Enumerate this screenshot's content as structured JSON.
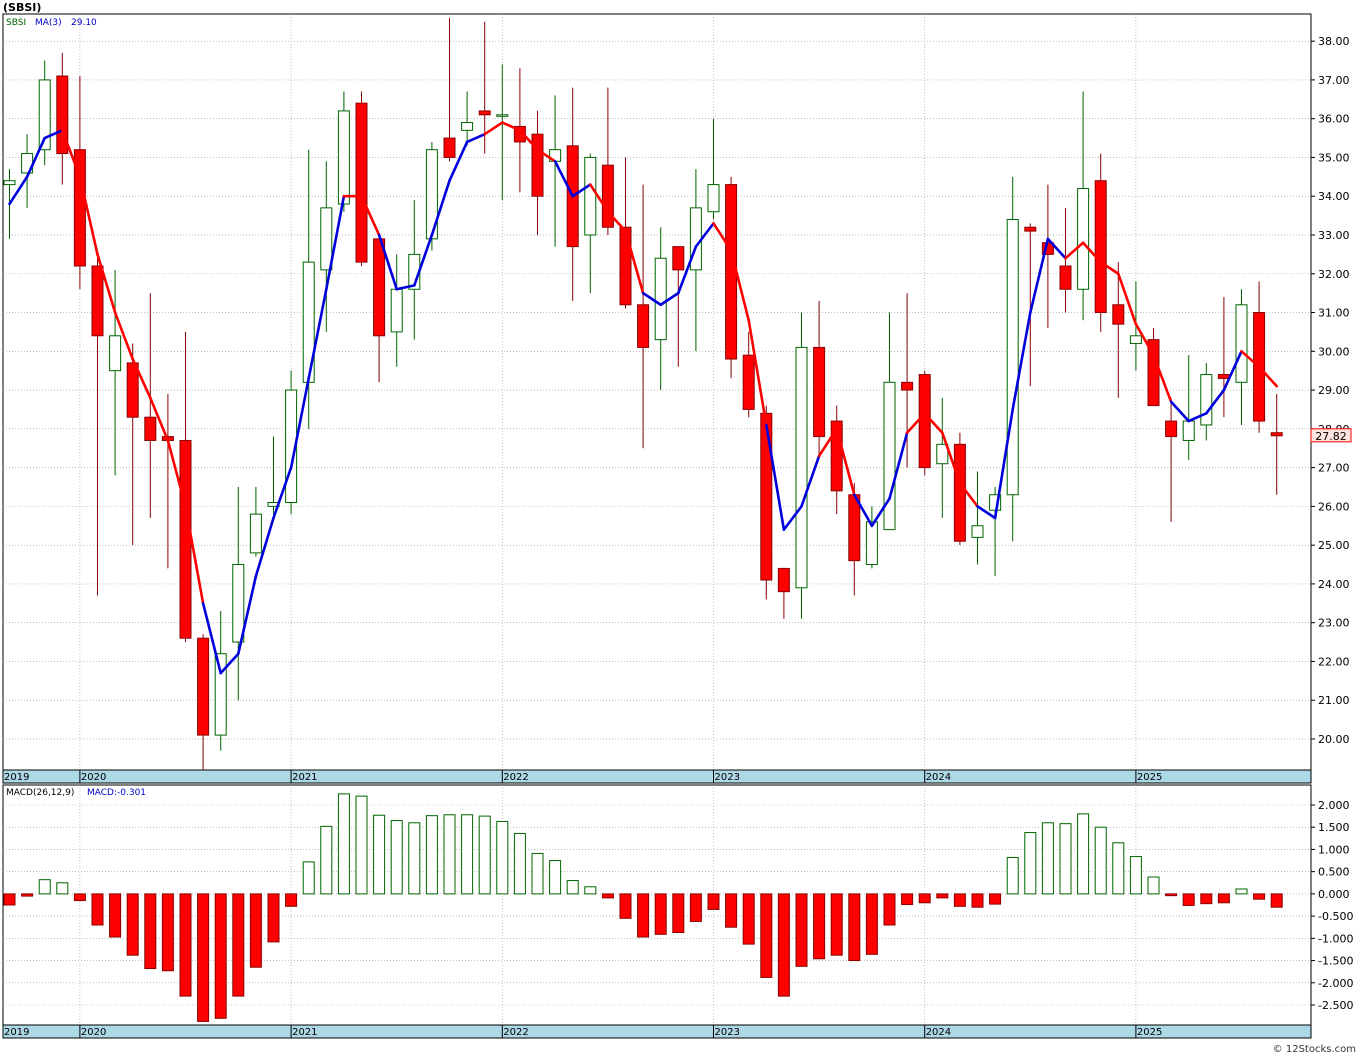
{
  "header": {
    "title": "(SBSI)"
  },
  "price_panel": {
    "symbol_label": "SBSI",
    "ma_label": "MA(3)",
    "ma_value": "29.10",
    "last_price": "27.82"
  },
  "macd_panel": {
    "label": "MACD(26,12,9)",
    "value_label": "MACD:-0.301"
  },
  "footer": {
    "credit": "© 12Stocks.com"
  },
  "colors": {
    "up": "#006400",
    "down": "#ff0000",
    "ma_up": "#0000dd",
    "ma_down": "#ff0000",
    "axis_band": "#add8e6",
    "grid": "#999999"
  },
  "chart_data": [
    {
      "type": "candlestick",
      "interval": "monthly",
      "ylim": [
        19.2,
        38.7
      ],
      "y_ticks": [
        "20.00",
        "21.00",
        "22.00",
        "23.00",
        "24.00",
        "25.00",
        "26.00",
        "27.00",
        "28.00",
        "29.00",
        "30.00",
        "31.00",
        "32.00",
        "33.00",
        "34.00",
        "35.00",
        "36.00",
        "37.00",
        "38.00"
      ],
      "x_labels": [
        "2019",
        "2020",
        "2021",
        "2022",
        "2023",
        "2024",
        "2025"
      ],
      "series": [
        {
          "name": "SBSI",
          "candles": [
            {
              "date": "2019-09",
              "o": 34.3,
              "h": 34.7,
              "l": 32.9,
              "c": 34.4
            },
            {
              "date": "2019-10",
              "o": 34.6,
              "h": 35.6,
              "l": 33.7,
              "c": 35.1
            },
            {
              "date": "2019-11",
              "o": 35.2,
              "h": 37.5,
              "l": 34.8,
              "c": 37.0
            },
            {
              "date": "2019-12",
              "o": 37.1,
              "h": 37.7,
              "l": 34.3,
              "c": 35.1
            },
            {
              "date": "2020-01",
              "o": 35.2,
              "h": 37.1,
              "l": 31.6,
              "c": 32.2
            },
            {
              "date": "2020-02",
              "o": 32.2,
              "h": 32.4,
              "l": 23.7,
              "c": 30.4
            },
            {
              "date": "2020-03",
              "o": 29.5,
              "h": 32.1,
              "l": 26.8,
              "c": 30.4
            },
            {
              "date": "2020-04",
              "o": 29.7,
              "h": 30.2,
              "l": 25.0,
              "c": 28.3
            },
            {
              "date": "2020-05",
              "o": 28.3,
              "h": 31.5,
              "l": 25.7,
              "c": 27.7
            },
            {
              "date": "2020-06",
              "o": 27.8,
              "h": 28.9,
              "l": 24.4,
              "c": 27.7
            },
            {
              "date": "2020-07",
              "o": 27.7,
              "h": 30.5,
              "l": 22.5,
              "c": 22.6
            },
            {
              "date": "2020-08",
              "o": 22.6,
              "h": 22.7,
              "l": 19.2,
              "c": 20.1
            },
            {
              "date": "2020-09",
              "o": 20.1,
              "h": 23.3,
              "l": 19.7,
              "c": 22.2
            },
            {
              "date": "2020-10",
              "o": 22.5,
              "h": 26.5,
              "l": 21.0,
              "c": 24.5
            },
            {
              "date": "2020-11",
              "o": 24.8,
              "h": 26.5,
              "l": 24.7,
              "c": 25.8
            },
            {
              "date": "2020-12",
              "o": 26.0,
              "h": 27.8,
              "l": 25.8,
              "c": 26.1
            },
            {
              "date": "2021-01",
              "o": 26.1,
              "h": 29.5,
              "l": 25.8,
              "c": 29.0
            },
            {
              "date": "2021-02",
              "o": 29.2,
              "h": 35.2,
              "l": 28.0,
              "c": 32.3
            },
            {
              "date": "2021-03",
              "o": 32.1,
              "h": 34.9,
              "l": 30.5,
              "c": 33.7
            },
            {
              "date": "2021-04",
              "o": 33.8,
              "h": 36.7,
              "l": 33.6,
              "c": 36.2
            },
            {
              "date": "2021-05",
              "o": 36.4,
              "h": 36.7,
              "l": 32.2,
              "c": 32.3
            },
            {
              "date": "2021-06",
              "o": 32.9,
              "h": 33.0,
              "l": 29.2,
              "c": 30.4
            },
            {
              "date": "2021-07",
              "o": 30.5,
              "h": 32.5,
              "l": 29.6,
              "c": 31.6
            },
            {
              "date": "2021-08",
              "o": 31.6,
              "h": 33.9,
              "l": 30.3,
              "c": 32.5
            },
            {
              "date": "2021-09",
              "o": 32.9,
              "h": 35.4,
              "l": 32.6,
              "c": 35.2
            },
            {
              "date": "2021-10",
              "o": 35.5,
              "h": 38.6,
              "l": 34.9,
              "c": 35.0
            },
            {
              "date": "2021-11",
              "o": 35.7,
              "h": 36.7,
              "l": 35.3,
              "c": 35.9
            },
            {
              "date": "2021-12",
              "o": 36.2,
              "h": 38.5,
              "l": 35.1,
              "c": 36.1
            },
            {
              "date": "2022-01",
              "o": 36.1,
              "h": 37.4,
              "l": 33.9,
              "c": 36.1
            },
            {
              "date": "2022-02",
              "o": 35.8,
              "h": 37.3,
              "l": 34.1,
              "c": 35.4
            },
            {
              "date": "2022-03",
              "o": 35.6,
              "h": 36.2,
              "l": 33.0,
              "c": 34.0
            },
            {
              "date": "2022-04",
              "o": 34.9,
              "h": 36.6,
              "l": 32.7,
              "c": 35.2
            },
            {
              "date": "2022-05",
              "o": 35.3,
              "h": 36.8,
              "l": 31.3,
              "c": 32.7
            },
            {
              "date": "2022-06",
              "o": 33.0,
              "h": 35.1,
              "l": 31.5,
              "c": 35.0
            },
            {
              "date": "2022-07",
              "o": 34.8,
              "h": 36.8,
              "l": 33.0,
              "c": 33.2
            },
            {
              "date": "2022-08",
              "o": 33.2,
              "h": 35.0,
              "l": 31.1,
              "c": 31.2
            },
            {
              "date": "2022-09",
              "o": 31.2,
              "h": 34.3,
              "l": 27.5,
              "c": 30.1
            },
            {
              "date": "2022-10",
              "o": 30.3,
              "h": 33.2,
              "l": 29.0,
              "c": 32.4
            },
            {
              "date": "2022-11",
              "o": 32.7,
              "h": 32.7,
              "l": 29.6,
              "c": 32.1
            },
            {
              "date": "2022-12",
              "o": 32.1,
              "h": 34.7,
              "l": 30.0,
              "c": 33.7
            },
            {
              "date": "2023-01",
              "o": 33.6,
              "h": 36.0,
              "l": 33.4,
              "c": 34.3
            },
            {
              "date": "2023-02",
              "o": 34.3,
              "h": 34.5,
              "l": 29.3,
              "c": 29.8
            },
            {
              "date": "2023-03",
              "o": 29.9,
              "h": 30.5,
              "l": 28.3,
              "c": 28.5
            },
            {
              "date": "2023-04",
              "o": 28.4,
              "h": 28.6,
              "l": 23.6,
              "c": 24.1
            },
            {
              "date": "2023-05",
              "o": 24.4,
              "h": 24.4,
              "l": 23.1,
              "c": 23.8
            },
            {
              "date": "2023-06",
              "o": 23.9,
              "h": 31.0,
              "l": 23.1,
              "c": 30.1
            },
            {
              "date": "2023-07",
              "o": 30.1,
              "h": 31.3,
              "l": 27.3,
              "c": 27.8
            },
            {
              "date": "2023-08",
              "o": 28.2,
              "h": 28.6,
              "l": 25.8,
              "c": 26.4
            },
            {
              "date": "2023-09",
              "o": 26.3,
              "h": 26.6,
              "l": 23.7,
              "c": 24.6
            },
            {
              "date": "2023-10",
              "o": 24.5,
              "h": 26.0,
              "l": 24.4,
              "c": 25.6
            },
            {
              "date": "2023-11",
              "o": 25.4,
              "h": 31.0,
              "l": 25.4,
              "c": 29.2
            },
            {
              "date": "2023-12",
              "o": 29.2,
              "h": 31.5,
              "l": 27.0,
              "c": 29.0
            },
            {
              "date": "2024-01",
              "o": 29.4,
              "h": 29.5,
              "l": 26.8,
              "c": 27.0
            },
            {
              "date": "2024-02",
              "o": 27.1,
              "h": 28.8,
              "l": 25.7,
              "c": 27.6
            },
            {
              "date": "2024-03",
              "o": 27.6,
              "h": 27.9,
              "l": 25.0,
              "c": 25.1
            },
            {
              "date": "2024-04",
              "o": 25.2,
              "h": 26.9,
              "l": 24.5,
              "c": 25.5
            },
            {
              "date": "2024-05",
              "o": 25.9,
              "h": 26.5,
              "l": 24.2,
              "c": 26.3
            },
            {
              "date": "2024-06",
              "o": 26.3,
              "h": 34.5,
              "l": 25.1,
              "c": 33.4
            },
            {
              "date": "2024-07",
              "o": 33.2,
              "h": 33.3,
              "l": 29.1,
              "c": 33.1
            },
            {
              "date": "2024-08",
              "o": 32.8,
              "h": 34.3,
              "l": 30.6,
              "c": 32.5
            },
            {
              "date": "2024-09",
              "o": 32.2,
              "h": 33.7,
              "l": 31.0,
              "c": 31.6
            },
            {
              "date": "2024-10",
              "o": 31.6,
              "h": 36.7,
              "l": 30.8,
              "c": 34.2
            },
            {
              "date": "2024-11",
              "o": 34.4,
              "h": 35.1,
              "l": 30.5,
              "c": 31.0
            },
            {
              "date": "2024-12",
              "o": 31.2,
              "h": 32.3,
              "l": 28.8,
              "c": 30.7
            },
            {
              "date": "2025-01",
              "o": 30.2,
              "h": 31.8,
              "l": 29.5,
              "c": 30.4
            },
            {
              "date": "2025-02",
              "o": 30.3,
              "h": 30.6,
              "l": 28.6,
              "c": 28.6
            },
            {
              "date": "2025-03",
              "o": 28.2,
              "h": 28.8,
              "l": 25.6,
              "c": 27.8
            },
            {
              "date": "2025-04",
              "o": 27.7,
              "h": 29.9,
              "l": 27.2,
              "c": 28.2
            },
            {
              "date": "2025-05",
              "o": 28.1,
              "h": 29.7,
              "l": 27.7,
              "c": 29.4
            },
            {
              "date": "2025-06",
              "o": 29.4,
              "h": 31.4,
              "l": 28.3,
              "c": 29.3
            },
            {
              "date": "2025-07",
              "o": 29.2,
              "h": 31.6,
              "l": 28.1,
              "c": 31.2
            },
            {
              "date": "2025-08",
              "o": 31.0,
              "h": 31.8,
              "l": 27.9,
              "c": 28.2
            },
            {
              "date": "2025-09",
              "o": 27.9,
              "h": 28.9,
              "l": 26.3,
              "c": 27.82
            }
          ]
        },
        {
          "name": "MA(3)",
          "values": [
            33.8,
            34.5,
            35.5,
            35.7,
            34.5,
            32.5,
            31.0,
            29.8,
            28.8,
            27.7,
            26.0,
            23.5,
            21.7,
            22.2,
            24.2,
            25.7,
            27.0,
            29.3,
            31.6,
            34.0,
            34.0,
            33.0,
            31.6,
            31.7,
            33.0,
            34.4,
            35.4,
            35.6,
            35.9,
            35.7,
            35.2,
            34.9,
            34.0,
            34.3,
            33.6,
            33.1,
            31.5,
            31.2,
            31.5,
            32.7,
            33.3,
            32.6,
            30.8,
            28.1,
            25.4,
            26.0,
            27.3,
            28.0,
            26.3,
            25.5,
            26.2,
            27.9,
            28.4,
            27.9,
            26.6,
            26.0,
            25.7,
            28.5,
            31.0,
            32.9,
            32.4,
            32.8,
            32.3,
            32.0,
            30.7,
            29.9,
            28.7,
            28.2,
            28.4,
            29.0,
            30.0,
            29.6,
            29.1
          ],
          "direction": [
            "up",
            "up",
            "up",
            "up",
            "down",
            "down",
            "down",
            "down",
            "down",
            "down",
            "down",
            "down",
            "up",
            "up",
            "up",
            "up",
            "up",
            "up",
            "up",
            "up",
            "down",
            "down",
            "up",
            "up",
            "up",
            "up",
            "up",
            "up",
            "down",
            "down",
            "down",
            "down",
            "up",
            "up",
            "down",
            "down",
            "down",
            "up",
            "up",
            "up",
            "up",
            "down",
            "down",
            "down",
            "up",
            "up",
            "up",
            "down",
            "down",
            "up",
            "up",
            "up",
            "down",
            "down",
            "down",
            "down",
            "up",
            "up",
            "up",
            "up",
            "up",
            "down",
            "down",
            "down",
            "down",
            "down",
            "down",
            "up",
            "up",
            "up",
            "up",
            "down",
            "down"
          ]
        }
      ]
    },
    {
      "type": "bar",
      "name": "MACD(26,12,9)",
      "ylim": [
        -2.95,
        2.45
      ],
      "y_ticks": [
        "2.000",
        "1.500",
        "1.000",
        "0.500",
        "0.000",
        "-0.500",
        "-1.000",
        "-1.500",
        "-2.000",
        "-2.500"
      ],
      "x_labels": [
        "2019",
        "2020",
        "2021",
        "2022",
        "2023",
        "2024",
        "2025"
      ],
      "values": [
        -0.25,
        -0.05,
        0.32,
        0.25,
        -0.15,
        -0.7,
        -0.97,
        -1.38,
        -1.68,
        -1.73,
        -2.3,
        -2.87,
        -2.8,
        -2.3,
        -1.65,
        -1.08,
        -0.28,
        0.72,
        1.52,
        2.25,
        2.2,
        1.77,
        1.65,
        1.6,
        1.76,
        1.78,
        1.78,
        1.75,
        1.63,
        1.36,
        0.91,
        0.75,
        0.3,
        0.16,
        -0.09,
        -0.55,
        -0.97,
        -0.91,
        -0.87,
        -0.62,
        -0.35,
        -0.75,
        -1.13,
        -1.88,
        -2.3,
        -1.63,
        -1.46,
        -1.38,
        -1.5,
        -1.36,
        -0.7,
        -0.24,
        -0.2,
        -0.09,
        -0.28,
        -0.3,
        -0.23,
        0.82,
        1.38,
        1.6,
        1.58,
        1.8,
        1.5,
        1.15,
        0.84,
        0.38,
        -0.04,
        -0.26,
        -0.22,
        -0.2,
        0.11,
        -0.12,
        -0.3
      ]
    }
  ]
}
